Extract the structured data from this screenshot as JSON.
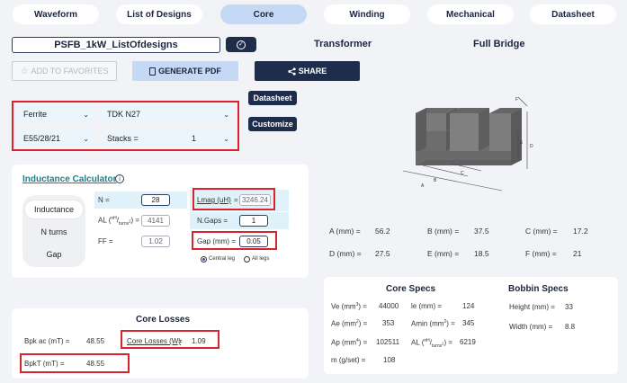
{
  "tabs": [
    {
      "label": "Waveform",
      "active": false
    },
    {
      "label": "List of Designs",
      "active": false
    },
    {
      "label": "Core",
      "active": true
    },
    {
      "label": "Winding",
      "active": false
    },
    {
      "label": "Mechanical",
      "active": false
    },
    {
      "label": "Datasheet",
      "active": false
    }
  ],
  "design_name": "PSFB_1kW_ListOfdesigns",
  "transformer_label": "Transformer",
  "topology_label": "Full Bridge",
  "buttons": {
    "add_favorites": "ADD TO FAVORITES",
    "generate_pdf": "GENERATE PDF",
    "share": "SHARE",
    "datasheet": "Datasheet",
    "customize": "Customize"
  },
  "icons": {
    "check": "check-circle-icon",
    "star": "star-icon",
    "pdf": "pdf-file-icon",
    "share": "share-icon",
    "info": "info-icon",
    "chevron": "chevron-down-icon"
  },
  "core_selection": {
    "material_type": "Ferrite",
    "material": "TDK N27",
    "shape": "E55/28/21",
    "stacks_label": "Stacks =",
    "stacks_value": "1"
  },
  "inductance_calculator": {
    "title": "Inductance Calculator",
    "modes": [
      "Inductance",
      "N turns",
      "Gap"
    ],
    "active_mode": "Inductance",
    "n_label": "N =",
    "n_value": "28",
    "al_label_prefix": "AL (",
    "al_label_sup": "nH",
    "al_label_mid": "/",
    "al_label_sub": "turns",
    "al_label_sub_sup": "2",
    "al_label_suffix": ") =",
    "al_value": "4141",
    "ff_label": "FF =",
    "ff_value": "1.02",
    "lmag_label": "Lmag (uH)",
    "lmag_suffix": "=",
    "lmag_value": "3246.24",
    "ngaps_label": "N.Gaps =",
    "ngaps_value": "1",
    "gap_label": "Gap (mm) =",
    "gap_value": "0.05",
    "radio_central": "Central leg",
    "radio_all": "All legs"
  },
  "core_losses": {
    "title": "Core Losses",
    "bpk_ac_label": "Bpk ac (mT) =",
    "bpk_ac_value": "48.55",
    "core_losses_label": "Core Losses (W)",
    "core_losses_suffix": "=",
    "core_losses_value": "1.09",
    "bpkt_label": "BpkT (mT) =",
    "bpkt_value": "48.55"
  },
  "dimensions": {
    "A_label": "A (mm) =",
    "A_value": "56.2",
    "B_label": "B (mm) =",
    "B_value": "37.5",
    "C_label": "C (mm) =",
    "C_value": "17.2",
    "D_label": "D (mm) =",
    "D_value": "27.5",
    "E_label": "E (mm) =",
    "E_value": "18.5",
    "F_label": "F (mm) =",
    "F_value": "21"
  },
  "drawing_letters": {
    "A": "A",
    "B": "B",
    "C": "C",
    "D": "D",
    "E": "E",
    "F": "F"
  },
  "core_specs": {
    "title": "Core Specs",
    "ve_label": "Ve (mm",
    "ve_sup": "3",
    "ve_suffix": ") =",
    "ve_value": "44000",
    "le_label": "le (mm) =",
    "le_value": "124",
    "ae_label": "Ae (mm",
    "ae_sup": "2",
    "ae_suffix": ") =",
    "ae_value": "353",
    "amin_label": "Amin (mm",
    "amin_sup": "2",
    "amin_suffix": ") =",
    "amin_value": "345",
    "ap_label": "Ap (mm",
    "ap_sup": "4",
    "ap_suffix": ") =",
    "ap_value": "102511",
    "al_label_prefix": "AL (",
    "al_sup": "nH",
    "al_mid": "/",
    "al_sub": "turns",
    "al_sub_sup": "2",
    "al_suffix": ") =",
    "al_value": "6219",
    "m_label": "m (g/set) =",
    "m_value": "108"
  },
  "bobbin_specs": {
    "title": "Bobbin Specs",
    "height_label": "Height (mm) =",
    "height_value": "33",
    "width_label": "Width (mm) =",
    "width_value": "8.8"
  }
}
